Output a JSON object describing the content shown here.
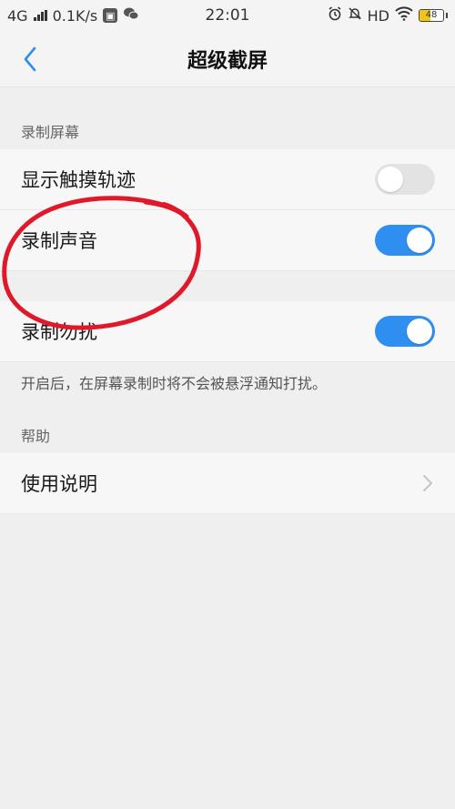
{
  "status_bar": {
    "network": "4G",
    "speed": "0.1K/s",
    "time": "22:01",
    "hd": "HD",
    "battery": "48",
    "battery_level": 0.48,
    "icons": [
      "signal-icon",
      "app-notification-icon",
      "wechat-icon",
      "alarm-icon",
      "mute-icon",
      "wifi-icon",
      "battery-icon"
    ]
  },
  "header": {
    "title": "超级截屏",
    "back_icon": "chevron-left-icon"
  },
  "sections": {
    "record_screen_label": "录制屏幕",
    "help_label": "帮助"
  },
  "rows": {
    "show_touch": {
      "label": "显示触摸轨迹",
      "enabled": false
    },
    "record_sound": {
      "label": "录制声音",
      "enabled": true
    },
    "do_not_disturb": {
      "label": "录制勿扰",
      "enabled": true
    },
    "usage_guide": {
      "label": "使用说明",
      "icon": "chevron-right-icon"
    }
  },
  "note": "开启后，在屏幕录制时将不会被悬浮通知打扰。",
  "colors": {
    "accent": "#2e8ff0",
    "annotation": "#e0192a",
    "background": "#efefef"
  }
}
